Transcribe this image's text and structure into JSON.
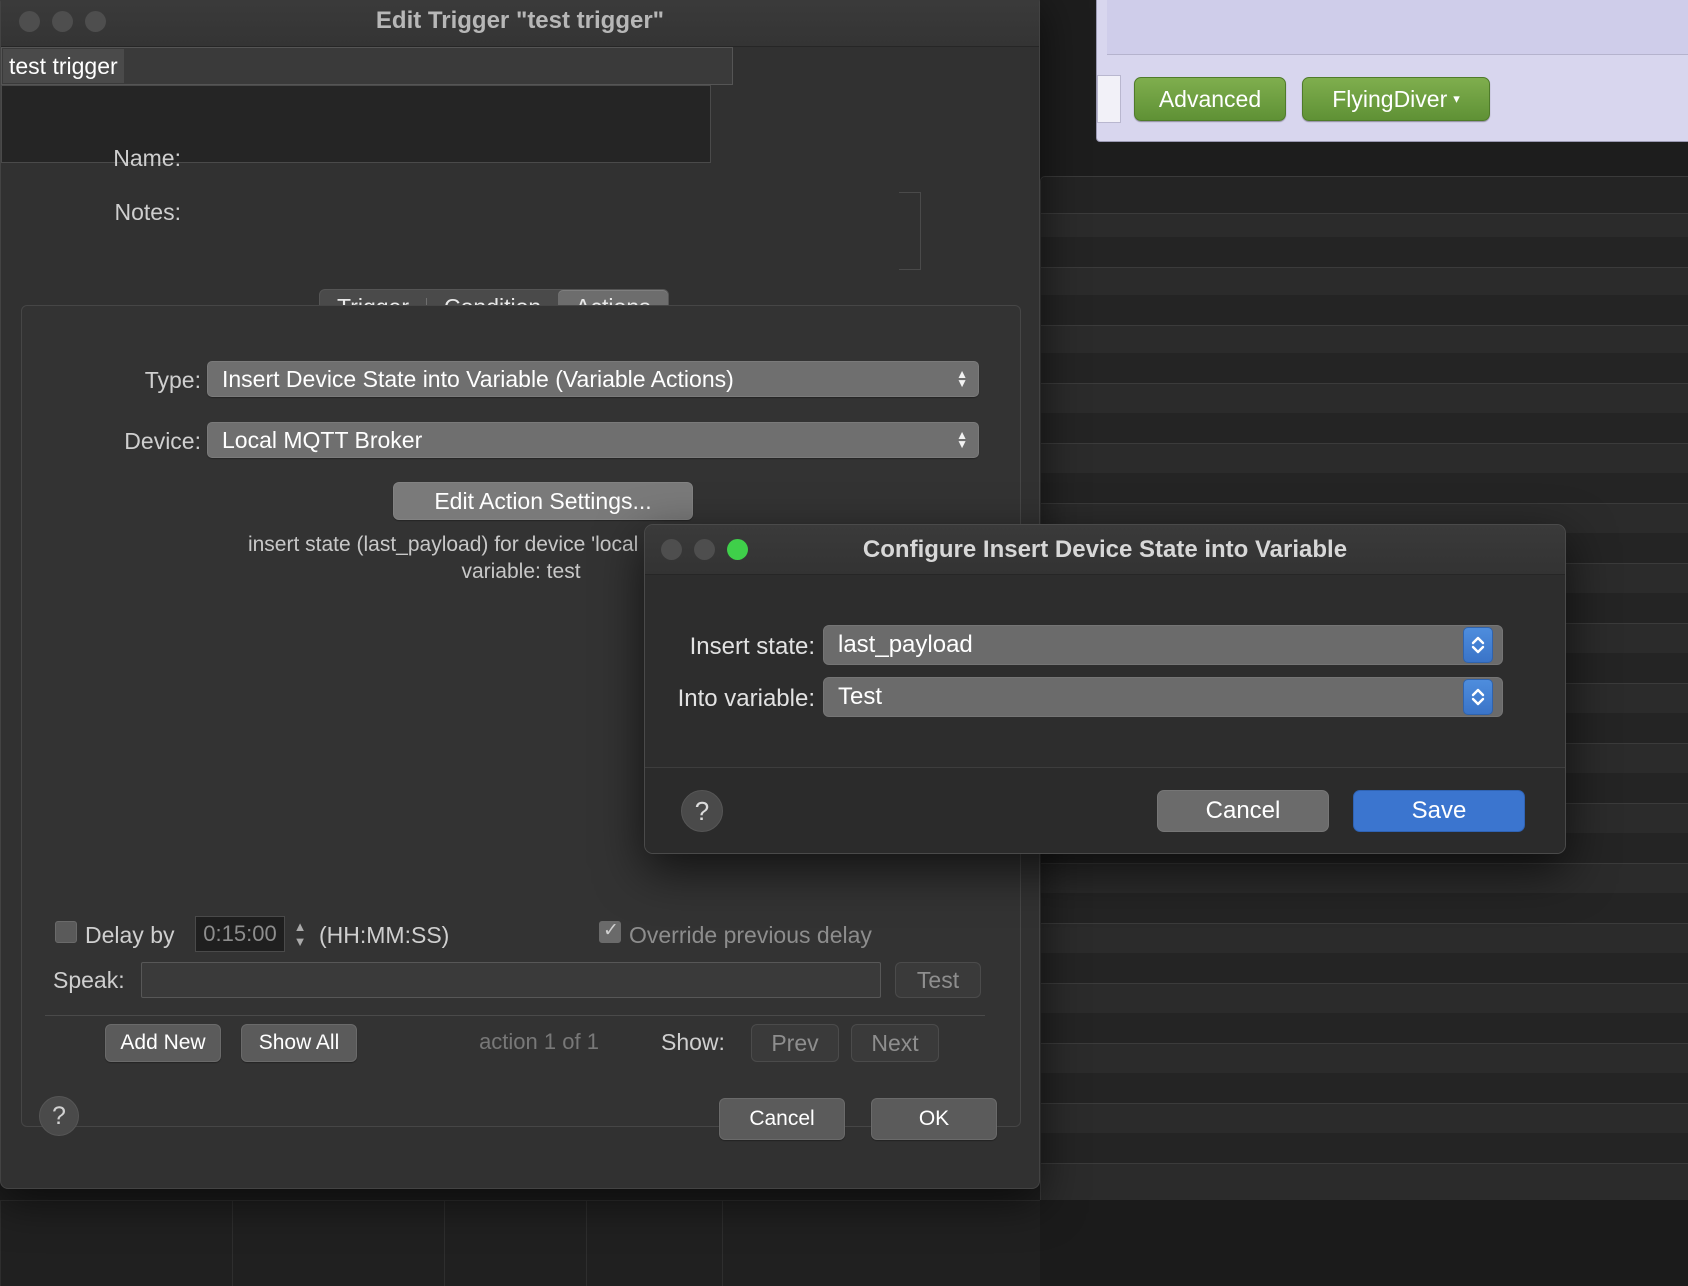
{
  "background": {
    "toolbar": {
      "advanced_label": "Advanced",
      "flyingdiver_label": "FlyingDiver",
      "flyingdiver_caret": "▾"
    }
  },
  "main_window": {
    "title": "Edit Trigger \"test trigger\"",
    "traffic_lights": [
      "close-button",
      "minimize-button",
      "zoom-button"
    ],
    "name_label": "Name:",
    "name_value": "test trigger",
    "notes_label": "Notes:",
    "notes_value": "",
    "tabs": [
      {
        "label": "Trigger",
        "active": false
      },
      {
        "label": "Condition",
        "active": false
      },
      {
        "label": "Actions",
        "active": true
      }
    ],
    "type_label": "Type:",
    "type_value": "Insert Device State into Variable (Variable Actions)",
    "device_label": "Device:",
    "device_value": "Local MQTT Broker",
    "edit_action_settings_label": "Edit Action Settings...",
    "description_line1": "insert state (last_payload) for device 'local mqtt broker' into",
    "description_line2": "variable: test",
    "delay_label": "Delay by",
    "delay_value": "0:15:00",
    "delay_format": "(HH:MM:SS)",
    "override_label": "Override previous delay",
    "speak_label": "Speak:",
    "speak_value": "",
    "test_label": "Test",
    "add_new_label": "Add New",
    "show_all_label": "Show All",
    "action_counter": "action 1 of 1",
    "show_label": "Show:",
    "prev_label": "Prev",
    "next_label": "Next",
    "help_label": "?",
    "cancel_label": "Cancel",
    "ok_label": "OK"
  },
  "sheet": {
    "title": "Configure Insert Device State into Variable",
    "insert_state_label": "Insert state:",
    "insert_state_value": "last_payload",
    "into_variable_label": "Into variable:",
    "into_variable_value": "Test",
    "help_label": "?",
    "cancel_label": "Cancel",
    "save_label": "Save"
  },
  "colors": {
    "accent_blue": "#3b75cf",
    "stepper_blue": "#4e8ddd",
    "green_button": "#5f9135",
    "window_bg": "#313131",
    "sheet_bg": "#2d2d2d"
  }
}
